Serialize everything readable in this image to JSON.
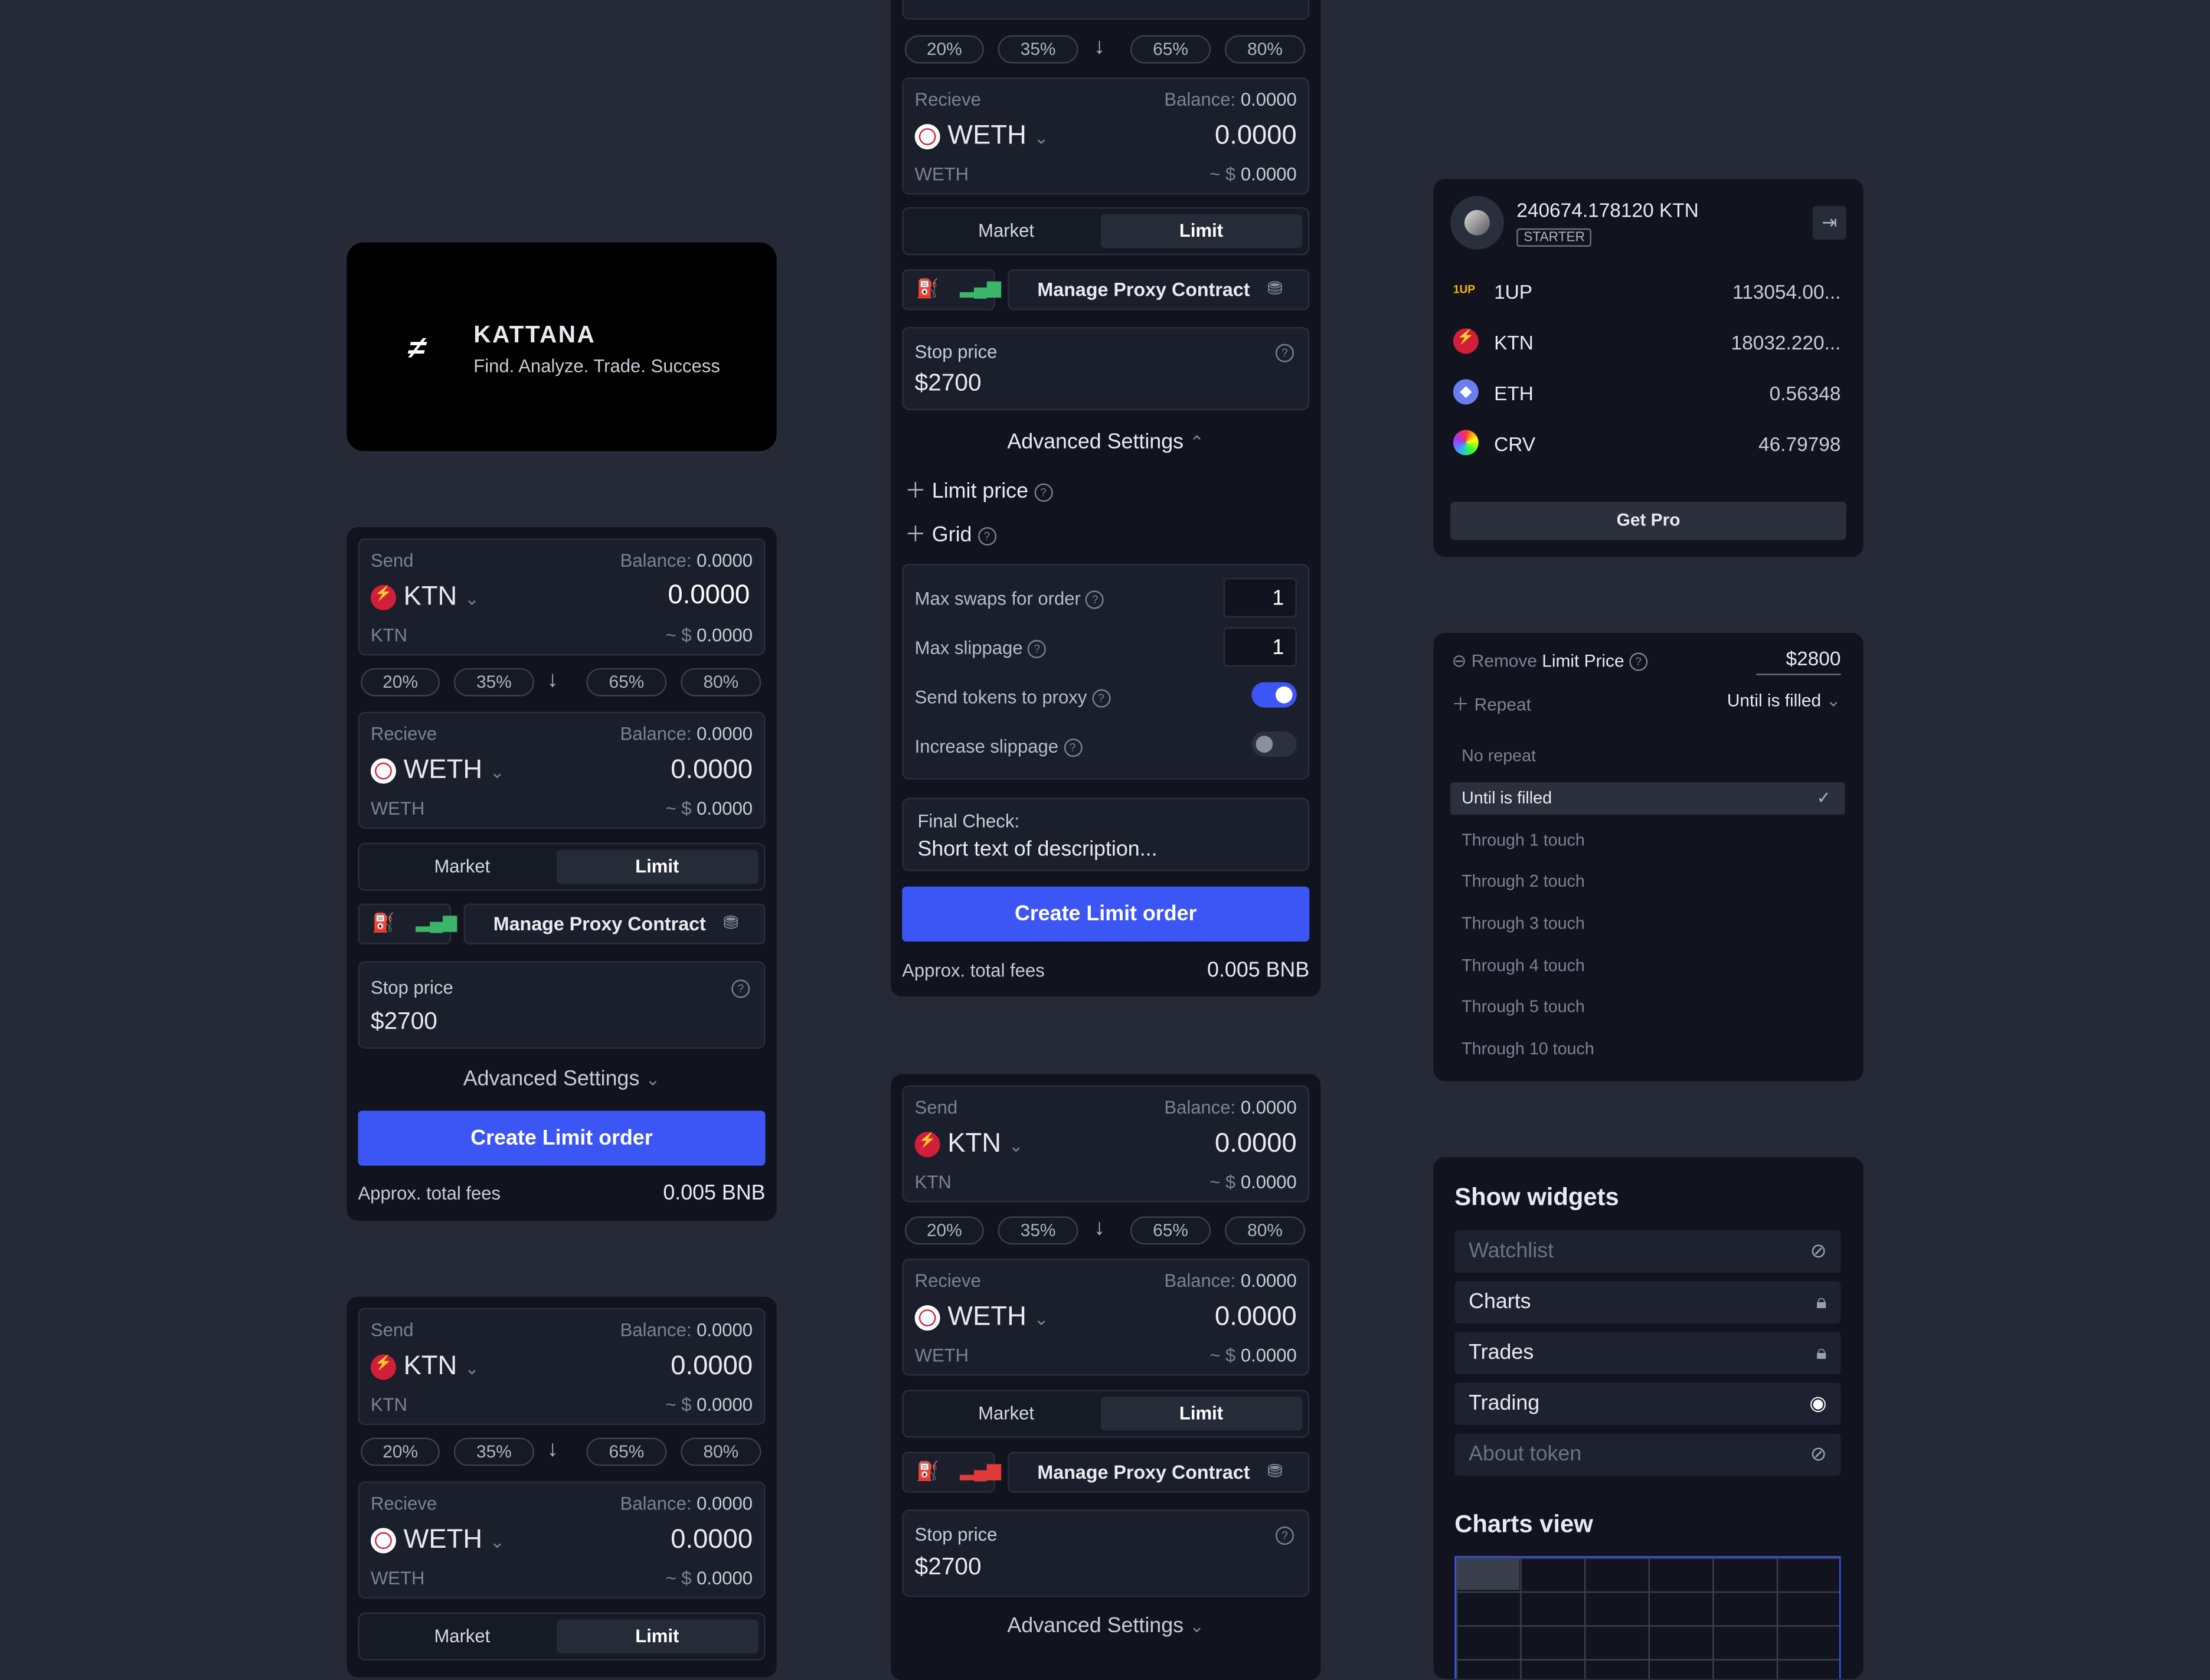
{
  "brand": {
    "name": "KATTANA",
    "tagline": "Find. Analyze. Trade. Success"
  },
  "swap": {
    "send_label": "Send",
    "receive_label": "Recieve",
    "balance_label": "Balance:",
    "balance_value": "0.0000",
    "send_token": "KTN",
    "receive_token": "WETH",
    "amount": "0.0000",
    "usd_prefix": "~ $",
    "usd_value": "0.0000",
    "percents": [
      "20%",
      "35%",
      "65%",
      "80%"
    ],
    "market_tab": "Market",
    "limit_tab": "Limit",
    "manage_proxy": "Manage Proxy Contract",
    "stop_price_label": "Stop price",
    "stop_price_value": "$2700",
    "advanced_settings": "Advanced Settings",
    "create_button": "Create Limit order",
    "fees_label": "Approx. total fees",
    "fees_value": "0.005 BNB"
  },
  "advanced": {
    "limit_price": "Limit price",
    "grid": "Grid",
    "max_swaps_label": "Max swaps for order",
    "max_swaps_value": "1",
    "max_slippage_label": "Max slippage",
    "max_slippage_value": "1",
    "send_to_proxy_label": "Send tokens to proxy",
    "send_to_proxy_on": true,
    "increase_slippage_label": "Increase slippage",
    "increase_slippage_on": false,
    "final_check_label": "Final Check:",
    "final_check_text": "Short text of description..."
  },
  "wallet": {
    "balance": "240674.178120 KTN",
    "tier": "STARTER",
    "tokens": [
      {
        "symbol": "1UP",
        "value": "113054.00...",
        "icon": "1up-icon"
      },
      {
        "symbol": "KTN",
        "value": "18032.220...",
        "icon": "ktn-icon"
      },
      {
        "symbol": "ETH",
        "value": "0.56348",
        "icon": "eth-icon"
      },
      {
        "symbol": "CRV",
        "value": "46.79798",
        "icon": "crv-icon"
      }
    ],
    "get_pro": "Get Pro"
  },
  "limit_price_dropdown": {
    "remove_label": "Remove",
    "limit_price_label": "Limit Price",
    "price": "$2800",
    "repeat_label": "Repeat",
    "repeat_value": "Until is filled",
    "options": [
      "No repeat",
      "Until is filled",
      "Through 1 touch",
      "Through 2 touch",
      "Through 3 touch",
      "Through 4 touch",
      "Through 5 touch",
      "Through 10 touch"
    ],
    "selected": "Until is filled"
  },
  "widgets": {
    "title": "Show widgets",
    "items": [
      {
        "label": "Watchlist",
        "state": "hidden"
      },
      {
        "label": "Charts",
        "state": "locked"
      },
      {
        "label": "Trades",
        "state": "locked"
      },
      {
        "label": "Trading",
        "state": "visible"
      },
      {
        "label": "About token",
        "state": "hidden"
      }
    ],
    "charts_view_title": "Charts view"
  },
  "colors": {
    "accent": "#3c55f5",
    "ktn": "#d11f3a",
    "green": "#3bb56a",
    "red": "#e03a3a"
  }
}
